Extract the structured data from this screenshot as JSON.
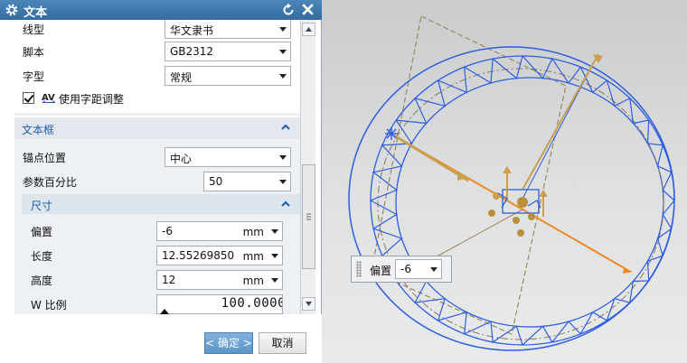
{
  "dialog": {
    "title": "文本",
    "fields": [
      {
        "label": "线型",
        "value": "华文隶书"
      },
      {
        "label": "脚本",
        "value": "GB2312"
      },
      {
        "label": "字型",
        "value": "常规"
      }
    ],
    "kerning": {
      "label": "使用字距调整",
      "checked": true
    }
  },
  "textbox": {
    "title": "文本框",
    "anchor": {
      "label": "锚点位置",
      "value": "中心"
    },
    "percent": {
      "label": "参数百分比",
      "value": "50"
    },
    "size": {
      "title": "尺寸",
      "offset": {
        "label": "偏置",
        "value": "-6",
        "unit": "mm"
      },
      "length": {
        "label": "长度",
        "value": "12.55269850",
        "unit": "mm"
      },
      "height": {
        "label": "高度",
        "value": "12",
        "unit": "mm"
      },
      "w_ratio": {
        "label": "W 比例",
        "value": "100.0000"
      }
    }
  },
  "footer": {
    "ok": "< 确定 >",
    "cancel": "取消"
  },
  "handle": {
    "label": "偏置",
    "value": "-6"
  },
  "colors": {
    "titlebar": "#336c9e",
    "accent": "#1d5ea8",
    "ring": "#2f5ee0",
    "arrow": "#f08a24",
    "gold": "#c8a050"
  }
}
